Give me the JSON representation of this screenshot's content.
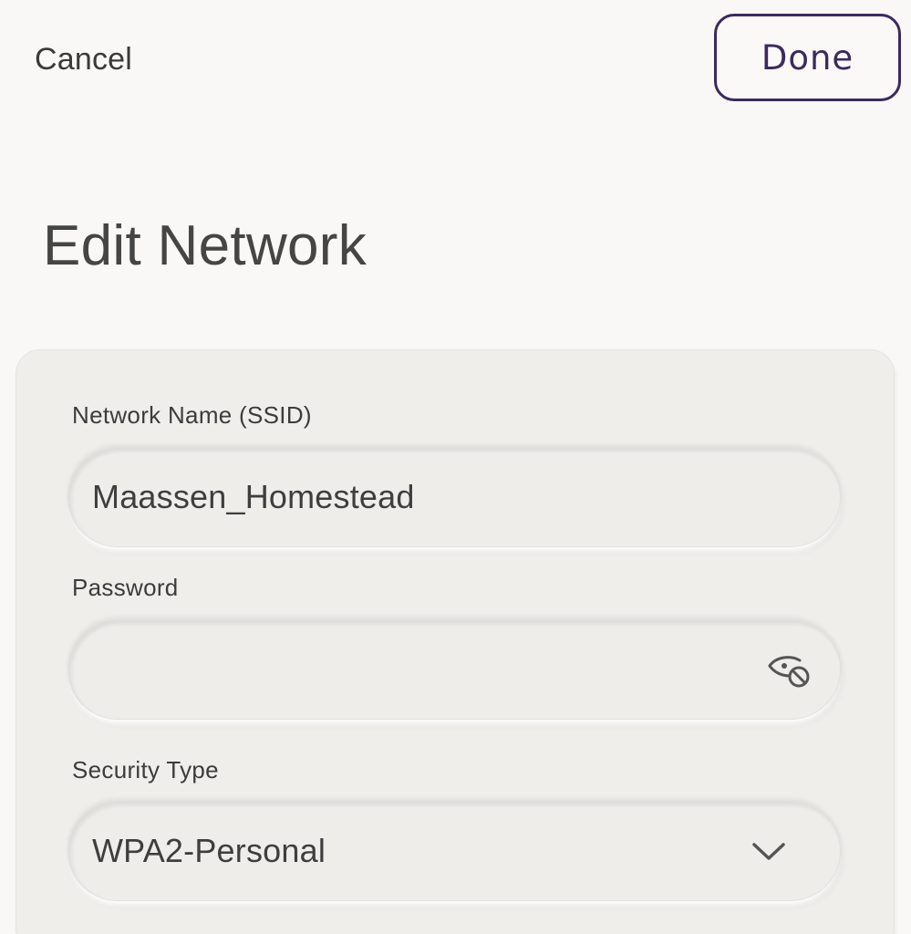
{
  "header": {
    "cancel_label": "Cancel",
    "done_label": "Done",
    "title": "Edit Network"
  },
  "form": {
    "ssid": {
      "label": "Network Name (SSID)",
      "value": "Maassen_Homestead"
    },
    "password": {
      "label": "Password",
      "value": "",
      "visibility_icon": "eye-slash-icon"
    },
    "security": {
      "label": "Security Type",
      "selected": "WPA2-Personal",
      "dropdown_icon": "chevron-down-icon"
    }
  },
  "colors": {
    "accent": "#3c2a5e",
    "background": "#f9f8f6",
    "card": "#efeeeb",
    "text": "#3c3c3c"
  }
}
